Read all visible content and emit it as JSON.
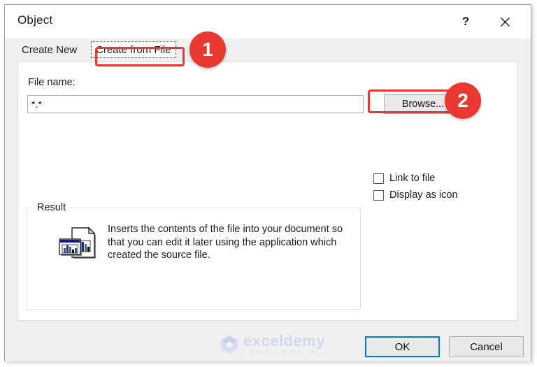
{
  "window": {
    "title": "Object",
    "help_icon": "question-mark-icon",
    "help_label": "?",
    "close_icon": "close-icon",
    "close_label": "✕"
  },
  "tabs": [
    {
      "label": "Create New",
      "selected": false
    },
    {
      "label": "Create from File",
      "selected": true
    }
  ],
  "form": {
    "file_name_label": "File name:",
    "file_name_value": "*.*",
    "file_name_placeholder": "",
    "browse_label": "Browse..."
  },
  "checkboxes": [
    {
      "label": "Link to file",
      "checked": false
    },
    {
      "label": "Display as icon",
      "checked": false
    }
  ],
  "result": {
    "group_title": "Result",
    "icon": "document-with-chart-icon",
    "description": "Inserts the contents of the file into your document so that you can edit it later using the application which created the source file."
  },
  "footer": {
    "ok_label": "OK",
    "cancel_label": "Cancel"
  },
  "watermark": {
    "name": "exceldemy",
    "tagline": "EXCEL · DATA · BI"
  },
  "annotations": {
    "color": "#e8382f",
    "badges": [
      {
        "number": "1",
        "target": "create-from-file-tab"
      },
      {
        "number": "2",
        "target": "browse-button"
      }
    ]
  },
  "colors": {
    "accent_focus": "#0078d7",
    "annotation_red": "#e8382f",
    "dialog_background": "#f0f0f0",
    "panel_background": "#ffffff"
  }
}
